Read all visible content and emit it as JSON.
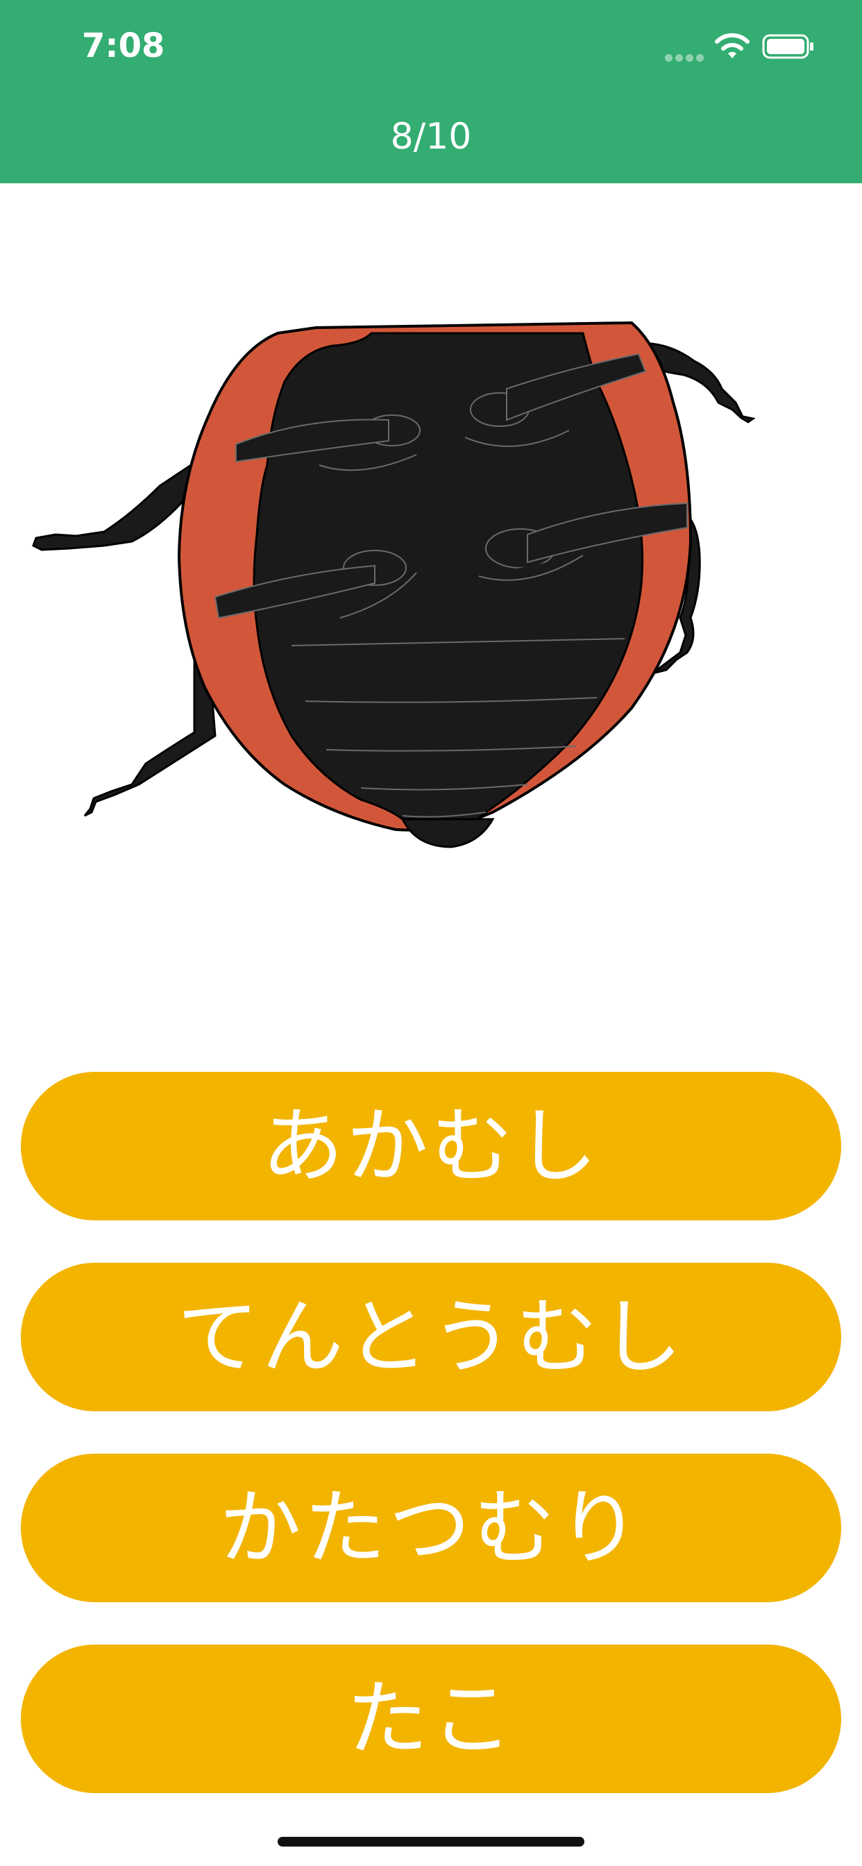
{
  "status_bar": {
    "time": "7:08"
  },
  "header": {
    "progress": "8/10",
    "color": "#33ad71"
  },
  "illustration": {
    "subject": "ladybug-underside",
    "colors": {
      "body": "#1a1a1a",
      "shell": "#d2573a"
    }
  },
  "answers": [
    {
      "label": "あかむし"
    },
    {
      "label": "てんとうむし"
    },
    {
      "label": "かたつむり"
    },
    {
      "label": "たこ"
    }
  ],
  "colors": {
    "answer_button": "#f3b400",
    "answer_text": "#ffffff"
  }
}
